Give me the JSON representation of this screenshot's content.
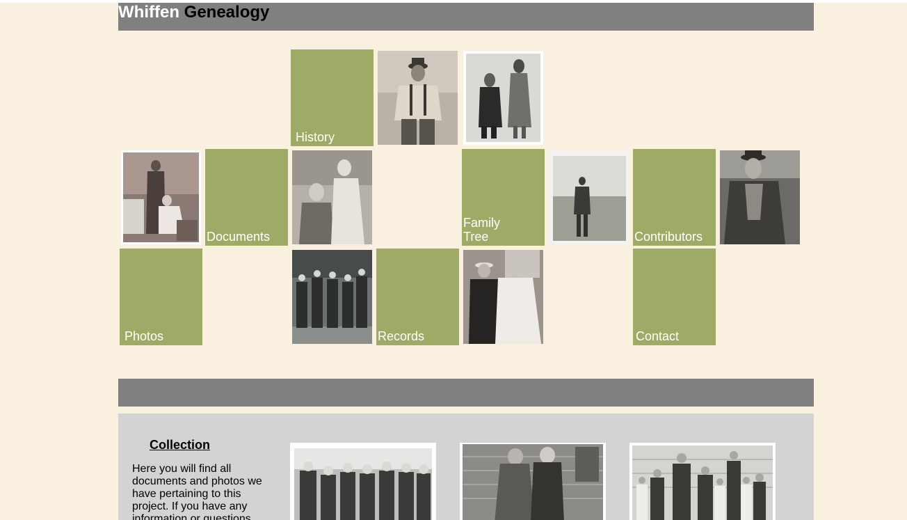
{
  "header": {
    "title_first": "Whiffen",
    "title_second": "Genealogy"
  },
  "nav": {
    "history": "History",
    "documents": "Documents",
    "family_tree_line1": "Family",
    "family_tree_line2": "Tree",
    "contributors": "Contributors",
    "photos": "Photos",
    "records": "Records",
    "contact": "Contact"
  },
  "collection": {
    "title": "Collection",
    "text": "Here you will find all documents and photos we have pertaining to this project. If you have any information or questions"
  },
  "colors": {
    "background": "#f9f0df",
    "bar": "#808080",
    "tile": "#9dab66",
    "panel": "#d3d3d3"
  }
}
